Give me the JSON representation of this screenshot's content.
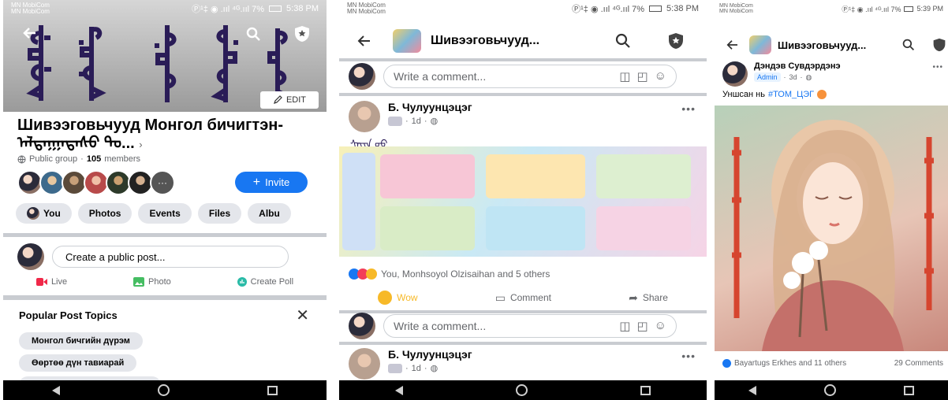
{
  "status": {
    "carrier_line1": "MN MobiCom",
    "carrier_line2": "MN MobiCom",
    "indicators_p1": "Ⓟ¹‡ ◉ .ııl ⁴ᴳ.ııl 7%",
    "time_p1": "5:38 PM",
    "indicators_p2": "Ⓟ¹‡ ◉ .ııl ⁴ᴳ.ııl 7%",
    "time_p2": "5:38 PM",
    "indicators_p3": "Ⓟ¹‡ ◉ .ııl ⁴ᴳ.ııl 7%",
    "time_p3": "5:39 PM"
  },
  "group": {
    "edit_label": "EDIT",
    "title": "Шивээговьчууд Монгол бичигтэн-ᠠᠯᠲᠠᠨ᠋ᠭᠠᠳᠠᠰᠤ ᠲᠣ...",
    "privacy": "Public group",
    "dot": "·",
    "members_count": "105",
    "members_word": "members",
    "more_members": "···",
    "invite_label": "Invite",
    "tabs": [
      "You",
      "Photos",
      "Events",
      "Files",
      "Albu"
    ]
  },
  "composer": {
    "placeholder": "Create a public post...",
    "live_label": "Live",
    "photo_label": "Photo",
    "poll_label": "Create Poll"
  },
  "topics": {
    "heading": "Popular Post Topics",
    "chips": [
      "Монгол бичгийн дүрэм",
      "Өөртөө дүн тавиарай"
    ]
  },
  "feed": {
    "bar_title": "Шивээговьчууд...",
    "comment_placeholder": "Write a comment...",
    "post1": {
      "author": "Б. Чулуунцэцэг",
      "time": "1d",
      "dot": "·",
      "text": "ᠰᠠᠶᠢᠨ ᠤᠤ",
      "reactions": "You, Monhsoyol Olzisaihan and 5 others"
    },
    "actions": {
      "wow": "Wow",
      "comment": "Comment",
      "share": "Share"
    },
    "post2": {
      "author": "Б. Чулуунцэцэг",
      "time": "1d",
      "dot": "·"
    }
  },
  "post_view": {
    "bar_title": "Шивээговьчууд...",
    "author": "Дэндэв Сувдэрдэнэ",
    "badge": "Admin",
    "time": "3d",
    "dot": "·",
    "text_prefix": "Уншсан нь",
    "hashtag": "#ТОМ_ЦЭГ",
    "reactions": "Bayartugs Erkhes and 11 others",
    "comments": "29 Comments"
  },
  "colors": {
    "accent": "#1877f2",
    "wow": "#f7b928",
    "live": "#f02849",
    "photo": "#45bd62",
    "poll": "#2abba7",
    "topic_dot": "#f7923b"
  }
}
